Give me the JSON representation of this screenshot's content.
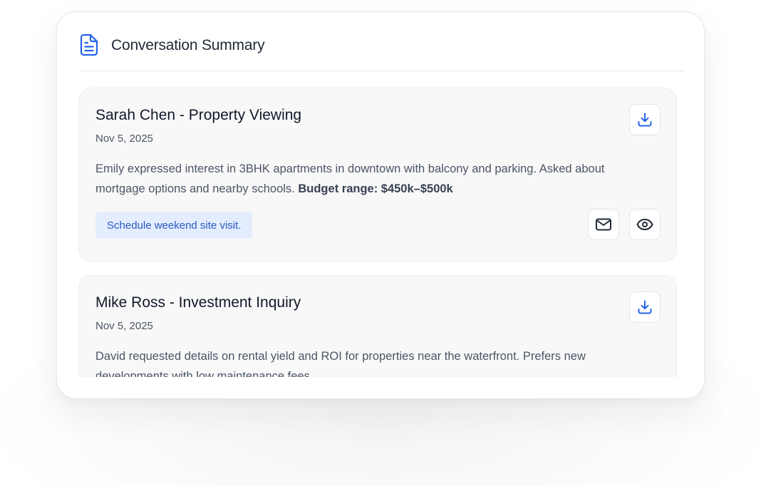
{
  "panel": {
    "title": "Conversation Summary",
    "header_icon": "document-icon"
  },
  "conversations": [
    {
      "name_title": "Sarah Chen - Property Viewing",
      "date": "Nov 5, 2025",
      "summary": "Emily expressed interest in 3BHK apartments in downtown with balcony and parking. Asked about mortgage options and nearby schools.",
      "budget": "Budget range: $450k–$500k",
      "action_tag": "Schedule weekend site visit.",
      "icons": [
        "download-icon",
        "mail-icon",
        "eye-icon"
      ]
    },
    {
      "name_title": "Mike Ross - Investment Inquiry",
      "date": "Nov 5, 2025",
      "summary": "David requested details on rental yield and ROI for properties near the waterfront. Prefers new developments with low maintenance fees.",
      "icons": [
        "download-icon"
      ]
    }
  ],
  "colors": {
    "accent": "#2a58c5",
    "tag_bg": "#e3edfd",
    "card_bg": "#f8f8f9",
    "icon_blue": "#2563eb"
  }
}
